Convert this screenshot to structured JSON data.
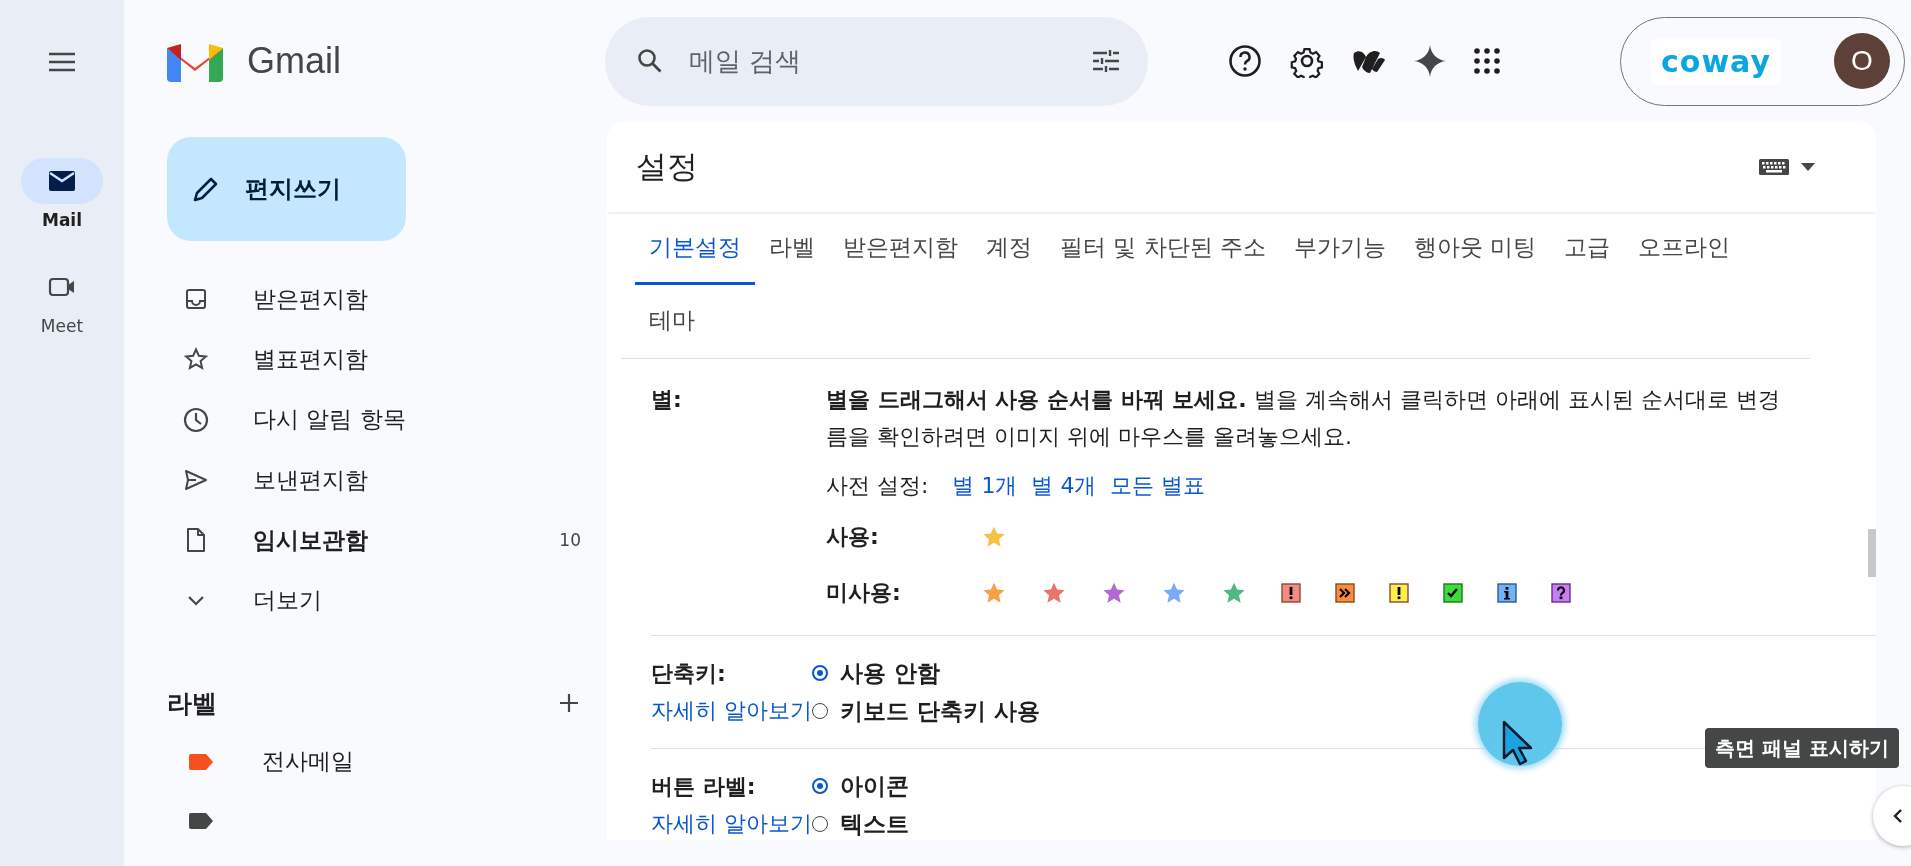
{
  "rail": [
    {
      "label": "Mail",
      "kind": "mail",
      "selected": true
    },
    {
      "label": "Meet",
      "kind": "meet",
      "selected": false
    }
  ],
  "app_name": "Gmail",
  "compose": "편지쓰기",
  "folders": [
    {
      "label": "받은편지함",
      "kind": "inbox",
      "bold": false
    },
    {
      "label": "별표편지함",
      "kind": "star",
      "bold": false
    },
    {
      "label": "다시 알림 항목",
      "kind": "clock",
      "bold": false
    },
    {
      "label": "보낸편지함",
      "kind": "send",
      "bold": false
    },
    {
      "label": "임시보관함",
      "kind": "file",
      "bold": true,
      "count": "10"
    },
    {
      "label": "더보기",
      "kind": "more",
      "bold": false
    }
  ],
  "labels_heading": "라벨",
  "labels": [
    {
      "name": "전사메일",
      "color": "#f4511e"
    },
    {
      "color": "#444746"
    }
  ],
  "search": {
    "placeholder": "메일 검색"
  },
  "account": {
    "org": "coway",
    "avatar": "O"
  },
  "settings": {
    "title": "설정",
    "tabs": [
      {
        "label": "기본설정",
        "selected": true
      },
      {
        "label": "라벨",
        "selected": false
      },
      {
        "label": "받은편지함",
        "selected": false
      },
      {
        "label": "계정",
        "selected": false
      },
      {
        "label": "필터 및 차단된 주소",
        "selected": false
      },
      {
        "label": "부가기능",
        "selected": false
      },
      {
        "label": "행아웃 미팅",
        "selected": false
      },
      {
        "label": "고급",
        "selected": false
      },
      {
        "label": "오프라인",
        "selected": false
      },
      {
        "label": "테마",
        "selected": false
      }
    ],
    "stars": {
      "label": "별:",
      "intro": "**별을 드래그해서 사용 순서를 바꿔 보세요.**  별을 계속해서 클릭하면 아래에 표시된 순서대로 변경",
      "intro_2": "름을 확인하려면 이미지 위에 마우스를 올려놓으세요.",
      "presets_label": "사전 설정:",
      "presets": [
        "별 1개",
        "별 4개",
        "모든 별표"
      ],
      "in_use_label": "사용:",
      "in_use": [
        {
          "kind": "star",
          "color": "#f7c244"
        }
      ],
      "unused_label": "미사용:",
      "unused": [
        {
          "kind": "star",
          "color": "#f6a04a"
        },
        {
          "kind": "star",
          "color": "#e8746a"
        },
        {
          "kind": "star",
          "color": "#b36bd0"
        },
        {
          "kind": "star",
          "color": "#7baaf7"
        },
        {
          "kind": "star",
          "color": "#4fb883"
        },
        {
          "kind": "bang",
          "color": "#f28b82"
        },
        {
          "kind": "guillemet",
          "color": "#fb8c3c"
        },
        {
          "kind": "bang",
          "color": "#fff049"
        },
        {
          "kind": "check",
          "color": "#3cdc3c"
        },
        {
          "kind": "info",
          "color": "#6fb3f5"
        },
        {
          "kind": "question",
          "color": "#c77ef0"
        }
      ]
    },
    "options": [
      {
        "label": "단축키:",
        "link": "자세히 알아보기",
        "choices": [
          {
            "label": "사용 안함",
            "selected": true
          },
          {
            "label": "키보드 단축키 사용",
            "selected": false
          }
        ]
      },
      {
        "label": "버튼 라벨:",
        "link": "자세히 알아보기",
        "choices": [
          {
            "label": "아이콘",
            "selected": true
          },
          {
            "label": "텍스트",
            "selected": false
          }
        ]
      }
    ]
  },
  "tooltip": "측면 패널 표시하기"
}
